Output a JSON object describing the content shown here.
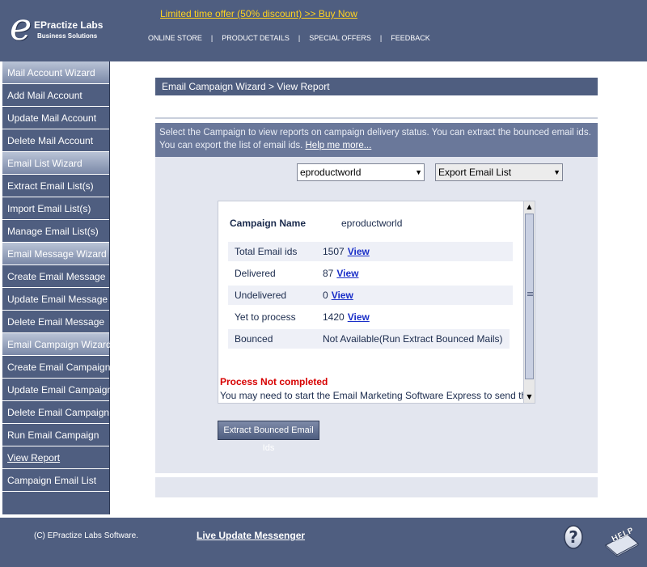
{
  "header": {
    "logo_e": "e",
    "logo_name": "EPractize Labs",
    "logo_sub": "Business Solutions",
    "promo": "Limited time offer (50% discount) >> Buy Now",
    "nav": [
      "ONLINE STORE",
      "PRODUCT DETAILS",
      "SPECIAL OFFERS",
      "FEEDBACK"
    ],
    "nav_sep": "|"
  },
  "sidebar": {
    "mail_head": "Mail Account Wizard",
    "mail_items": [
      "Add Mail Account",
      "Update Mail Account",
      "Delete Mail Account"
    ],
    "list_head": "Email List Wizard",
    "list_items": [
      "Extract Email List(s)",
      "Import Email List(s)",
      "Manage Email List(s)"
    ],
    "message_head": "Email Message Wizard",
    "message_items": [
      "Create Email Message",
      "Update Email Message",
      "Delete Email Message"
    ],
    "campaign_head": "Email Campaign Wizard",
    "campaign_items": [
      "Create Email Campaign",
      "Update Email Campaign",
      "Delete Email Campaign",
      "Run Email Campaign",
      "View Report",
      "Campaign Email List"
    ]
  },
  "main": {
    "title": "Email Campaign Wizard > View Report",
    "info": "Select the Campaign to view reports on campaign delivery status. You can extract the bounced email ids. You can export the list of email ids.",
    "help_link": "Help me more...",
    "campaign_select": "eproductworld",
    "export_select": "Export Email List",
    "dropdown_arrow": "▼"
  },
  "report": {
    "campaign_label": "Campaign Name",
    "campaign_value": "eproductworld",
    "rows": [
      {
        "label": "Total Email ids",
        "value": "1507",
        "link": "View"
      },
      {
        "label": "Delivered",
        "value": "87",
        "link": "View"
      },
      {
        "label": "Undelivered",
        "value": "0",
        "link": "View"
      },
      {
        "label": "Yet to process",
        "value": "1420",
        "link": "View"
      },
      {
        "label": "Bounced",
        "value": "Not Available(Run Extract Bounced Mails)",
        "link": ""
      }
    ],
    "status": "Process Not completed",
    "note": "You may need to start the Email Marketing Software Express to send the",
    "scroll_up": "▲",
    "scroll_down": "▼"
  },
  "extract_button": "Extract Bounced Email Ids",
  "footer": {
    "copyright": "(C) EPractize Labs Software.",
    "live_update": "Live Update Messenger",
    "help_icon_text": "HELP",
    "question_mark": "?"
  }
}
